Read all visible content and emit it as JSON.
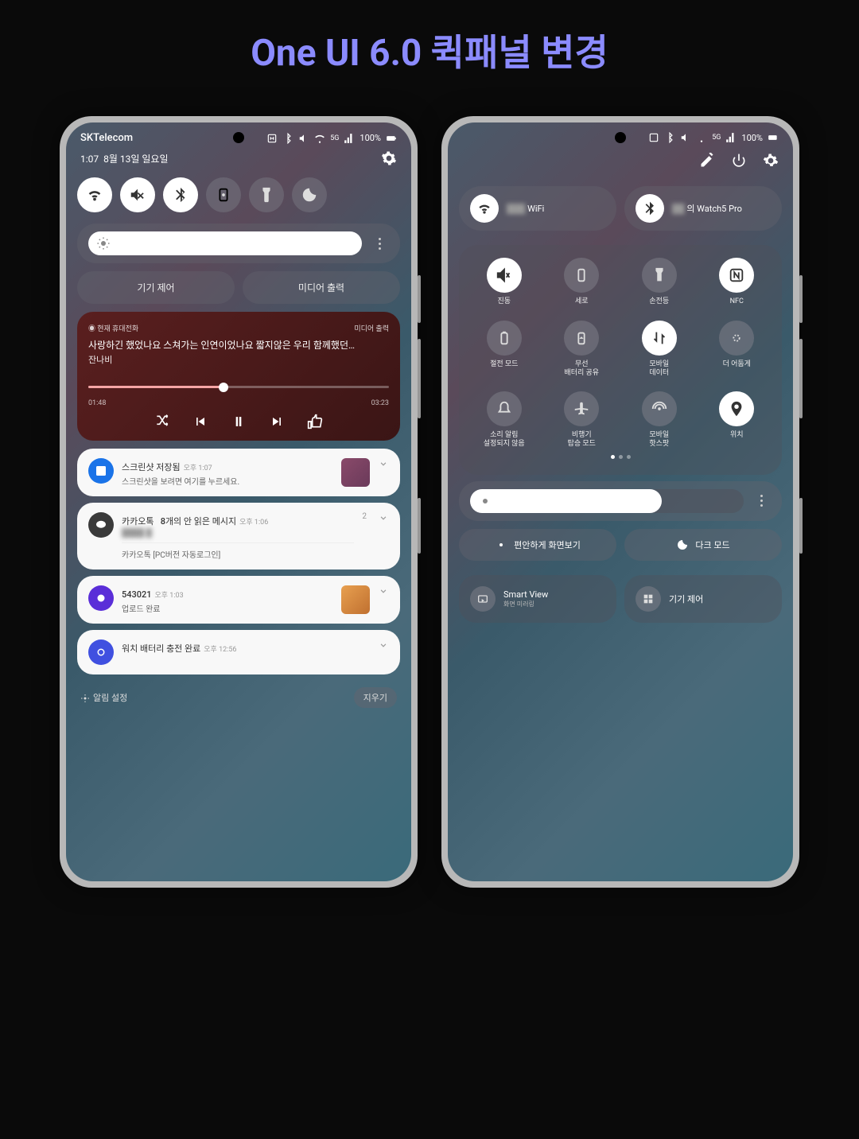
{
  "page_title": "One UI 6.0 퀵패널 변경",
  "left": {
    "carrier": "SKTelecom",
    "battery": "100%",
    "time": "1:07",
    "date": "8월 13일 일요일",
    "quick_toggles": [
      {
        "name": "wifi",
        "active": true
      },
      {
        "name": "mute",
        "active": true
      },
      {
        "name": "bluetooth",
        "active": true
      },
      {
        "name": "rotation",
        "active": false
      },
      {
        "name": "flashlight",
        "active": false
      },
      {
        "name": "dnd",
        "active": false
      }
    ],
    "buttons": {
      "device": "기기 제어",
      "media": "미디어 출력"
    },
    "media": {
      "source": "현재 휴대전화",
      "output": "미디어 출력",
      "title": "사랑하긴 했었나요 스쳐가는 인연이었나요 짧지않은 우리 함께했던…",
      "artist": "잔나비",
      "elapsed": "01:48",
      "total": "03:23"
    },
    "notifications": [
      {
        "icon_color": "#1a73e8",
        "title": "스크린샷 저장됨",
        "time": "오후 1:07",
        "body": "스크린샷을 보려면 여기를 누르세요.",
        "has_thumb": true
      },
      {
        "icon_color": "#3a3a3a",
        "title": "카카오톡",
        "title_extra": "8개의 안 읽은 메시지",
        "time": "오후 1:06",
        "body_blur": "blurred",
        "sub": "카카오톡   [PC버전 자동로그인]",
        "count": "2"
      },
      {
        "icon_color": "#5a2ed8",
        "title": "543021",
        "time": "오후 1:03",
        "body": "업로드 완료",
        "has_thumb": true
      },
      {
        "icon_color": "#4050e0",
        "title": "워치 배터리 충전 완료",
        "time": "오후 12:56"
      }
    ],
    "footer": {
      "settings": "알림 설정",
      "clear": "지우기"
    }
  },
  "right": {
    "battery": "100%",
    "big_tiles": [
      {
        "label": "WiFi",
        "icon": "wifi"
      },
      {
        "label": "의 Watch5 Pro",
        "icon": "bluetooth"
      }
    ],
    "grid": [
      [
        {
          "label": "진동",
          "icon": "mute",
          "active": true
        },
        {
          "label": "세로",
          "icon": "rotation",
          "active": false
        },
        {
          "label": "손전등",
          "icon": "flashlight",
          "active": false
        },
        {
          "label": "NFC",
          "icon": "nfc",
          "active": true
        }
      ],
      [
        {
          "label": "절전 모드",
          "icon": "battery",
          "active": false
        },
        {
          "label": "무선\n배터리 공유",
          "icon": "share",
          "active": false
        },
        {
          "label": "모바일\n데이터",
          "icon": "data",
          "active": true
        },
        {
          "label": "더 어둡게",
          "icon": "dim",
          "active": false
        }
      ],
      [
        {
          "label": "소리 알림\n설정되지 않음",
          "icon": "bell",
          "active": false
        },
        {
          "label": "비행기\n탑승 모드",
          "icon": "airplane",
          "active": false
        },
        {
          "label": "모바일\n핫스팟",
          "icon": "hotspot",
          "active": false
        },
        {
          "label": "위치",
          "icon": "location",
          "active": true
        }
      ]
    ],
    "modes": {
      "eye": "편안하게 화면보기",
      "dark": "다크 모드"
    },
    "bottom": {
      "smartview": {
        "title": "Smart View",
        "sub": "화면 미러링"
      },
      "device": "기기 제어"
    }
  }
}
